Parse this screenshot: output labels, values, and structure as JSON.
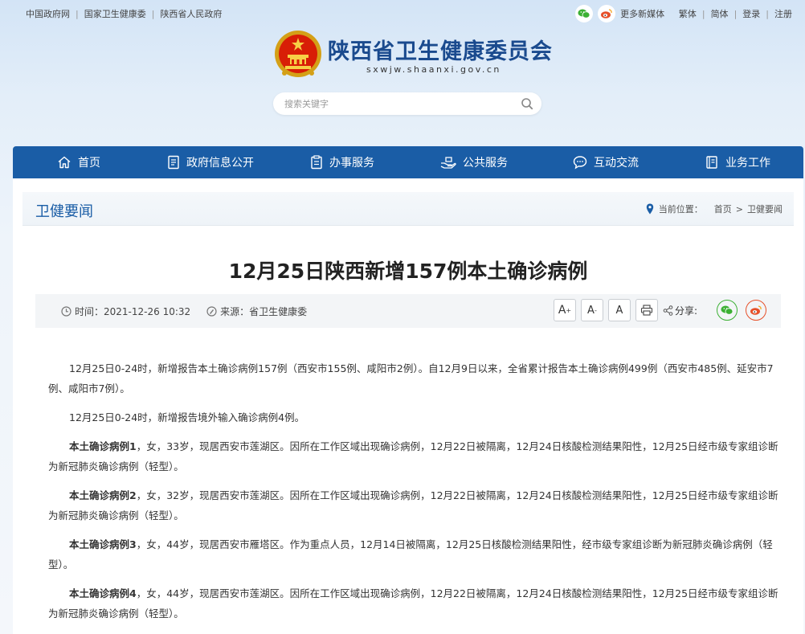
{
  "topbar": {
    "links": [
      "中国政府网",
      "国家卫生健康委",
      "陕西省人民政府"
    ],
    "more_media": "更多新媒体",
    "traditional": "繁体",
    "simplified": "简体",
    "login": "登录",
    "register": "注册"
  },
  "header": {
    "title": "陕西省卫生健康委员会",
    "domain": "sxwjw.shaanxi.gov.cn"
  },
  "search": {
    "placeholder": "搜索关键字"
  },
  "nav": {
    "items": [
      {
        "label": "首页",
        "icon": "home-icon"
      },
      {
        "label": "政府信息公开",
        "icon": "document-icon"
      },
      {
        "label": "办事服务",
        "icon": "clipboard-icon"
      },
      {
        "label": "公共服务",
        "icon": "hands-icon"
      },
      {
        "label": "互动交流",
        "icon": "chat-icon"
      },
      {
        "label": "业务工作",
        "icon": "book-icon"
      }
    ]
  },
  "section": {
    "title": "卫健要闻",
    "location_label": "当前位置：",
    "crumb_home": "首页",
    "crumb_sep": ">",
    "crumb_current": "卫健要闻"
  },
  "article": {
    "title": "12月25日陕西新增157例本土确诊病例",
    "time_label": "时间：",
    "time": "2021-12-26 10:32",
    "source_label": "来源：",
    "source": "省卫生健康委",
    "share_label": "分享:",
    "font_large": "A",
    "font_medium": "A",
    "font_small": "A",
    "paragraphs": [
      {
        "bold": "",
        "text": "12月25日0-24时，新增报告本土确诊病例157例（西安市155例、咸阳市2例）。自12月9日以来，全省累计报告本土确诊病例499例（西安市485例、延安市7例、咸阳市7例）。"
      },
      {
        "bold": "",
        "text": "12月25日0-24时，新增报告境外输入确诊病例4例。"
      },
      {
        "bold": "本土确诊病例1",
        "text": "，女，33岁，现居西安市莲湖区。因所在工作区域出现确诊病例，12月22日被隔离，12月24日核酸检测结果阳性，12月25日经市级专家组诊断为新冠肺炎确诊病例（轻型）。"
      },
      {
        "bold": "本土确诊病例2",
        "text": "，女，32岁，现居西安市莲湖区。因所在工作区域出现确诊病例，12月22日被隔离，12月24日核酸检测结果阳性，12月25日经市级专家组诊断为新冠肺炎确诊病例（轻型）。"
      },
      {
        "bold": "本土确诊病例3",
        "text": "，女，44岁，现居西安市雁塔区。作为重点人员，12月14日被隔离，12月25日核酸检测结果阳性，经市级专家组诊断为新冠肺炎确诊病例（轻型）。"
      },
      {
        "bold": "本土确诊病例4",
        "text": "，女，44岁，现居西安市莲湖区。因所在工作区域出现确诊病例，12月22日被隔离，12月24日核酸检测结果阳性，12月25日经市级专家组诊断为新冠肺炎确诊病例（轻型）。"
      }
    ]
  },
  "colors": {
    "nav_bg": "#1a5da6",
    "title_blue": "#1a4a8e",
    "wechat_green": "#3cb034",
    "weibo_orange": "#e6502a"
  }
}
